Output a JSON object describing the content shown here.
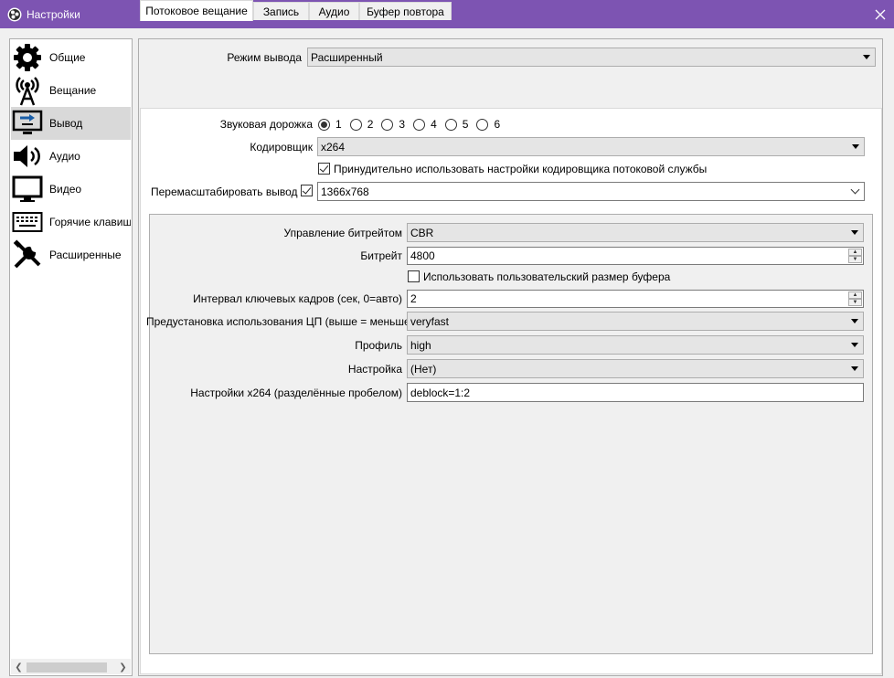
{
  "window": {
    "title": "Настройки"
  },
  "sidebar": {
    "items": [
      {
        "label": "Общие",
        "icon": "gear-icon"
      },
      {
        "label": "Вещание",
        "icon": "broadcast-tower-icon"
      },
      {
        "label": "Вывод",
        "icon": "output-monitor-icon"
      },
      {
        "label": "Аудио",
        "icon": "speaker-icon"
      },
      {
        "label": "Видео",
        "icon": "monitor-icon"
      },
      {
        "label": "Горячие клавиши",
        "icon": "keyboard-icon"
      },
      {
        "label": "Расширенные",
        "icon": "tools-icon"
      }
    ],
    "selected_index": 2
  },
  "output_mode": {
    "label": "Режим вывода",
    "value": "Расширенный"
  },
  "tabs": [
    {
      "label": "Потоковое вещание"
    },
    {
      "label": "Запись"
    },
    {
      "label": "Аудио"
    },
    {
      "label": "Буфер повтора"
    }
  ],
  "streaming": {
    "audio_track": {
      "label": "Звуковая дорожка",
      "options": [
        "1",
        "2",
        "3",
        "4",
        "5",
        "6"
      ],
      "selected": "1"
    },
    "encoder": {
      "label": "Кодировщик",
      "value": "x264"
    },
    "enforce_settings": {
      "label": "Принудительно использовать настройки кодировщика потоковой службы",
      "checked": true
    },
    "rescale": {
      "label": "Перемасштабировать вывод",
      "checked": true,
      "value": "1366x768"
    }
  },
  "encoder_settings": {
    "rate_control": {
      "label": "Управление битрейтом",
      "value": "CBR"
    },
    "bitrate": {
      "label": "Битрейт",
      "value": "4800"
    },
    "custom_buffer": {
      "label": "Использовать пользовательский размер буфера",
      "checked": false
    },
    "keyframe_interval": {
      "label": "Интервал ключевых кадров (сек, 0=авто)",
      "value": "2"
    },
    "cpu_preset": {
      "label": "Предустановка использования ЦП (выше = меньше)",
      "value": "veryfast"
    },
    "profile": {
      "label": "Профиль",
      "value": "high"
    },
    "tune": {
      "label": "Настройка",
      "value": "(Нет)"
    },
    "x264_options": {
      "label": "Настройки x264 (разделённые пробелом)",
      "value": "deblock=1:2"
    }
  },
  "colors": {
    "titlebar": "#7d54b2",
    "selected_item": "#d9d9d9"
  }
}
